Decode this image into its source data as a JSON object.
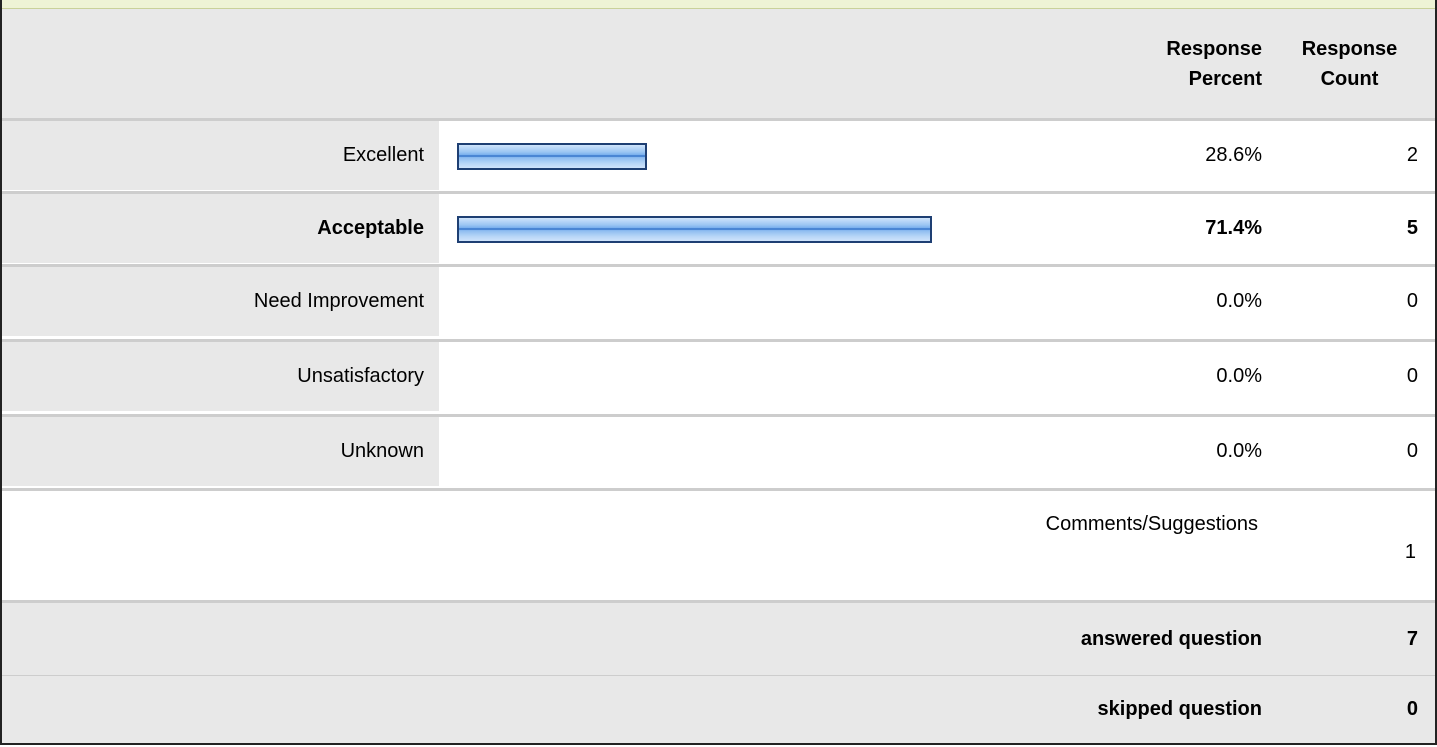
{
  "header": {
    "percent_line1": "Response",
    "percent_line2": "Percent",
    "count_line1": "Response",
    "count_line2": "Count"
  },
  "rows": [
    {
      "label": "Excellent",
      "percent": "28.6%",
      "count": "2",
      "fraction": 0.286,
      "bold": false
    },
    {
      "label": "Acceptable",
      "percent": "71.4%",
      "count": "5",
      "fraction": 0.714,
      "bold": true
    },
    {
      "label": "Need Improvement",
      "percent": "0.0%",
      "count": "0",
      "fraction": 0.0,
      "bold": false
    },
    {
      "label": "Unsatisfactory",
      "percent": "0.0%",
      "count": "0",
      "fraction": 0.0,
      "bold": false
    },
    {
      "label": "Unknown",
      "percent": "0.0%",
      "count": "0",
      "fraction": 0.0,
      "bold": false
    }
  ],
  "comments": {
    "label": "Comments/Suggestions",
    "count": "1"
  },
  "summary": {
    "answered_label": "answered question",
    "answered_count": "7",
    "skipped_label": "skipped question",
    "skipped_count": "0"
  },
  "colors": {
    "bar_fill": "#6ba6ea",
    "bar_border": "#1e3f73",
    "label_bg": "#e8e8e8",
    "row_divider": "#cdcdcd"
  }
}
